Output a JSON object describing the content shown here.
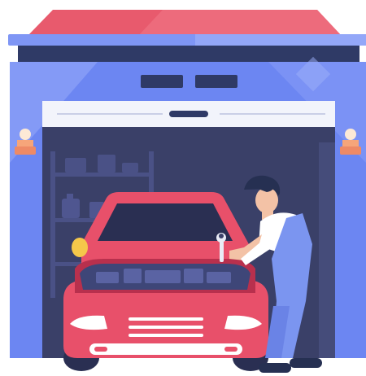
{
  "illustration": {
    "subject": "mechanic-repairing-car-in-garage",
    "colors": {
      "roof": "#e85a6d",
      "roof_highlight": "#f07a88",
      "garage_wall": "#6c86f2",
      "garage_wall_light": "#8ea2f8",
      "garage_trim": "#7f96f5",
      "garage_dark": "#2f3a66",
      "door_frame": "#f2f4fb",
      "interior": "#3a4068",
      "car_body": "#e8506a",
      "car_dark": "#b8304d",
      "windshield": "#2a2f52",
      "engine": "#3e4678",
      "mechanic_shirt": "#ffffff",
      "mechanic_overalls": "#7b95f0",
      "mechanic_hair": "#263052",
      "skin": "#f3c2a6",
      "lamp": "#f6a57a"
    },
    "icons": [
      "wall-lamp-icon",
      "wrench-icon",
      "shelf-icon",
      "fuel-can-icon"
    ]
  }
}
